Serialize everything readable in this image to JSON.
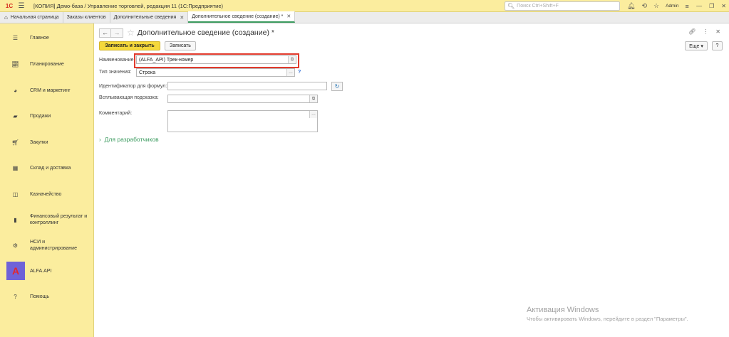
{
  "titlebar": {
    "logo": "1С",
    "title": "[КОПИЯ] Демо-база / Управление торговлей, редакция 11  (1С:Предприятие)",
    "search_placeholder": "Поиск Ctrl+Shift+F",
    "user": "Admin"
  },
  "tabs": [
    {
      "label": "Начальная страница"
    },
    {
      "label": "Заказы клиентов"
    },
    {
      "label": "Дополнительные сведения"
    },
    {
      "label": "Дополнительное сведение (создание) *"
    }
  ],
  "sidebar": {
    "items": [
      {
        "label": "Главное",
        "icon": "menu-icon"
      },
      {
        "label": "Планирование",
        "icon": "chart-icon"
      },
      {
        "label": "CRM и маркетинг",
        "icon": "pie-icon"
      },
      {
        "label": "Продажи",
        "icon": "bag-icon"
      },
      {
        "label": "Закупки",
        "icon": "cart-icon"
      },
      {
        "label": "Склад и доставка",
        "icon": "grid-icon"
      },
      {
        "label": "Казначейство",
        "icon": "coins-icon"
      },
      {
        "label": "Финансовый результат и контроллинг",
        "icon": "bars-icon"
      },
      {
        "label": "НСИ и администрирование",
        "icon": "gear-icon"
      },
      {
        "label": "ALFA.API",
        "icon": "alfa-logo"
      },
      {
        "label": "Помощь",
        "icon": "help-icon"
      }
    ]
  },
  "form": {
    "title": "Дополнительное сведение (создание) *",
    "save_close_label": "Записать и закрыть",
    "save_label": "Записать",
    "more_label": "Еще ▾",
    "help_label": "?",
    "name_label": "Наименование:",
    "name_value": "(ALFA_API) Трек-номер",
    "type_label": "Тип значения:",
    "type_value": "Строка",
    "formula_label": "Идентификатор для формул:",
    "formula_value": "",
    "tooltip_label": "Всплывающая подсказка:",
    "tooltip_value": "",
    "comment_label": "Комментарий:",
    "comment_value": "",
    "dev_group_label": "Для разработчиков"
  },
  "watermark": {
    "line1": "Активация Windows",
    "line2": "Чтобы активировать Windows, перейдите в раздел \"Параметры\"."
  },
  "colors": {
    "sidebar_bg": "#fbed9e",
    "primary_button": "#f5d83b",
    "highlight_border": "#e13a2c",
    "accent_green": "#3b9b5f",
    "alfa_bg": "#6f62d8"
  }
}
